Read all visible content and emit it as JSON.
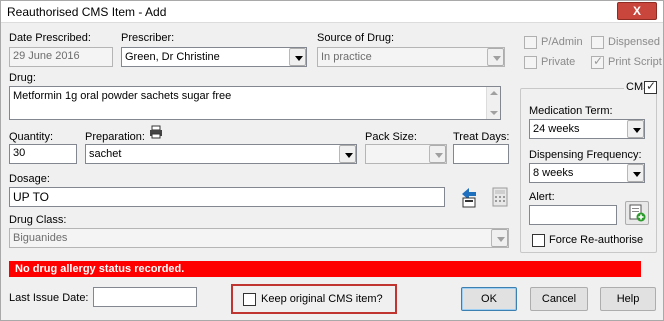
{
  "window": {
    "title": "Reauthorised CMS Item - Add",
    "close_label": "X"
  },
  "fields": {
    "date_prescribed": {
      "label": "Date Prescribed:",
      "value": "29 June 2016"
    },
    "prescriber": {
      "label": "Prescriber:",
      "value": "Green, Dr Christine"
    },
    "source_of_drug": {
      "label": "Source of Drug:",
      "value": "In practice"
    },
    "drug": {
      "label": "Drug:",
      "value": "Metformin 1g oral powder sachets sugar free"
    },
    "quantity": {
      "label": "Quantity:",
      "value": "30"
    },
    "preparation": {
      "label": "Preparation:",
      "value": "sachet"
    },
    "pack_size": {
      "label": "Pack Size:",
      "value": ""
    },
    "treat_days": {
      "label": "Treat Days:",
      "value": ""
    },
    "dosage": {
      "label": "Dosage:",
      "value": "UP TO"
    },
    "drug_class": {
      "label": "Drug Class:",
      "value": "Biguanides"
    },
    "last_issue_date": {
      "label": "Last Issue Date:",
      "value": ""
    }
  },
  "options": {
    "p_admin": {
      "label": "P/Admin",
      "checked": false
    },
    "dispensed": {
      "label": "Dispensed",
      "checked": false
    },
    "private": {
      "label": "Private",
      "checked": false
    },
    "print_script": {
      "label": "Print Script",
      "checked": true
    }
  },
  "cms": {
    "label": "CMS",
    "checked": true,
    "medication_term": {
      "label": "Medication Term:",
      "value": "24 weeks"
    },
    "dispensing_frequency": {
      "label": "Dispensing Frequency:",
      "value": "8 weeks"
    },
    "alert": {
      "label": "Alert:",
      "value": ""
    },
    "force_reauthorise": {
      "label": "Force Re-authorise",
      "checked": false
    }
  },
  "status": {
    "message": "No drug allergy status recorded.",
    "color": "#ff0000"
  },
  "keep_original": {
    "label": "Keep original CMS item?",
    "checked": false
  },
  "buttons": {
    "ok": "OK",
    "cancel": "Cancel",
    "help": "Help"
  },
  "icons": {
    "preparation": "printer-icon",
    "dosage": "dosage-picker-icon",
    "calculator": "calculator-icon",
    "alert": "add-note-icon"
  },
  "tick_glyph": "✓"
}
